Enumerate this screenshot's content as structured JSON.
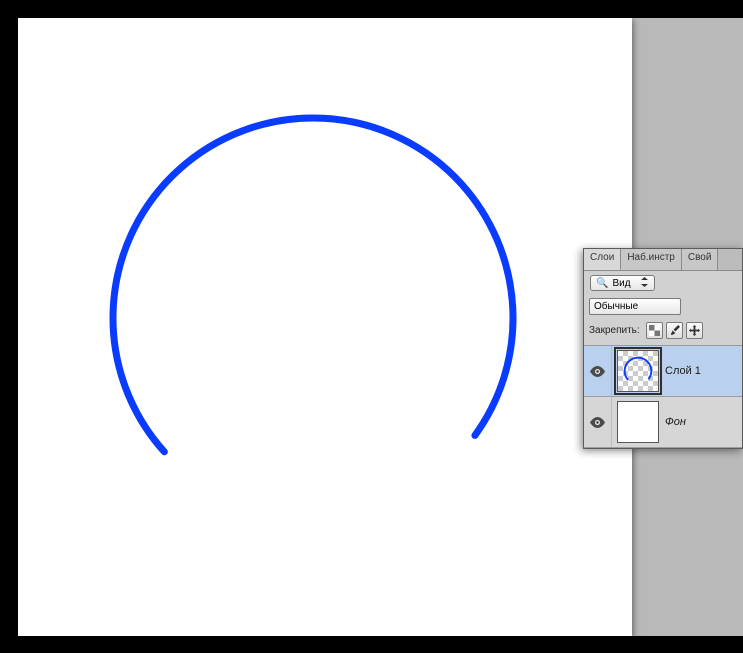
{
  "panel": {
    "tabs": {
      "layers": "Слои",
      "tool_presets": "Наб.инстр",
      "properties": "Свой"
    },
    "search": {
      "kind_label": "Вид"
    },
    "blend_mode": "Обычные",
    "lock_label": "Закрепить:",
    "layers": [
      {
        "name": "Слой 1",
        "visible": true,
        "selected": true,
        "type": "transparent-arc"
      },
      {
        "name": "Фон",
        "visible": true,
        "selected": false,
        "type": "white"
      }
    ]
  }
}
